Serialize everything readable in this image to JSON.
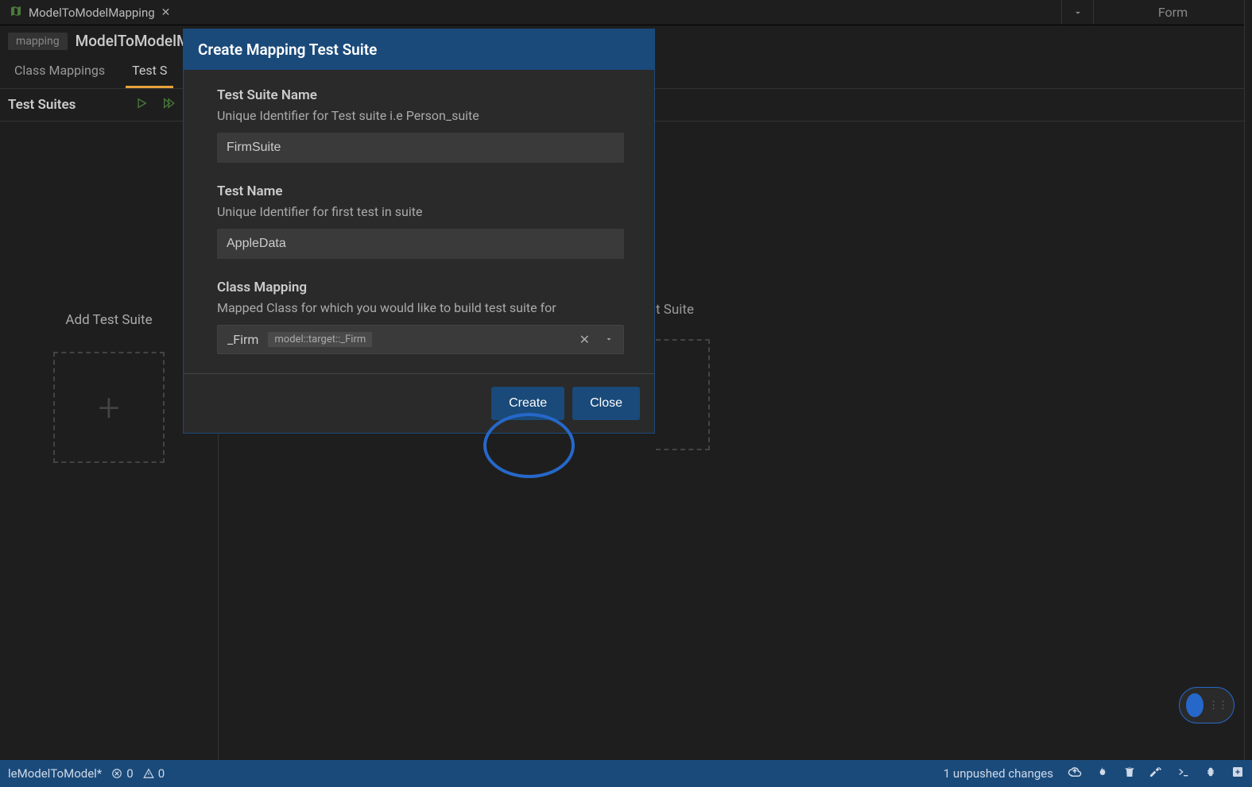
{
  "tab": {
    "title": "ModelToModelMapping"
  },
  "topRight": {
    "formLabel": "Form"
  },
  "breadcrumb": {
    "badge": "mapping",
    "title": "ModelToModelM"
  },
  "subTabs": {
    "classMappings": "Class Mappings",
    "testSuites": "Test S"
  },
  "panel": {
    "title": "Test Suites",
    "addLabel": "Add Test Suite"
  },
  "bgPanel": {
    "suiteLabelPartial": "t Suite"
  },
  "modal": {
    "title": "Create Mapping Test Suite",
    "fields": {
      "testSuiteName": {
        "label": "Test Suite Name",
        "hint": "Unique Identifier for Test suite i.e Person_suite",
        "value": "FirmSuite"
      },
      "testName": {
        "label": "Test Name",
        "hint": "Unique Identifier for first test in suite",
        "value": "AppleData"
      },
      "classMapping": {
        "label": "Class Mapping",
        "hint": "Mapped Class for which you would like to build test suite for",
        "value": "_Firm",
        "chip": "model::target::_Firm"
      }
    },
    "buttons": {
      "create": "Create",
      "close": "Close"
    }
  },
  "statusBar": {
    "project": "leModelToModel*",
    "errors": "0",
    "warnings": "0",
    "unpushed": "1 unpushed changes"
  }
}
